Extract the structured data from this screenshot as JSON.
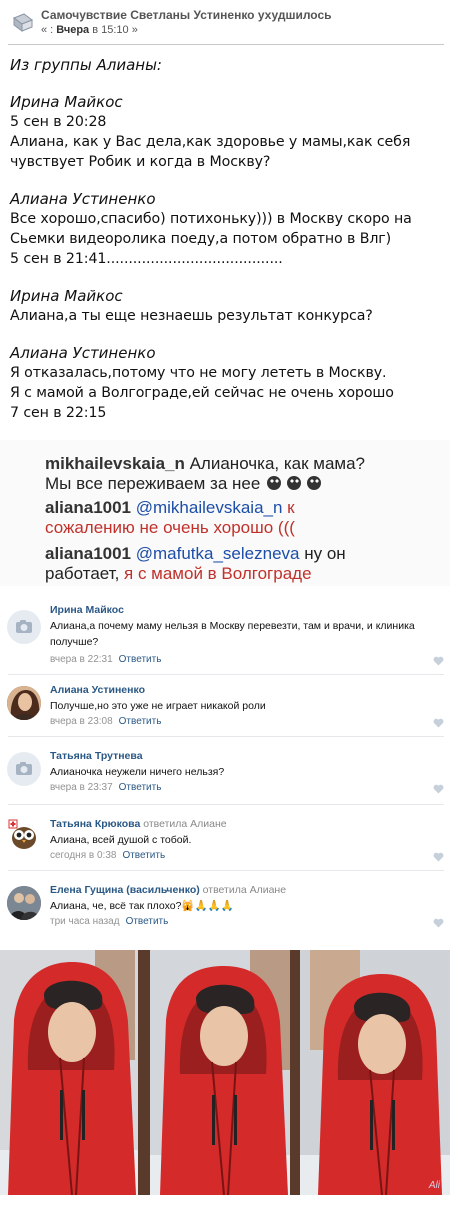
{
  "header": {
    "title": "Самочувствие Светланы Устиненко ухудшилось",
    "sub_prefix": "« : ",
    "sub_date": "Вчера",
    "sub_time": " в 15:10 »"
  },
  "quote": {
    "group_label": "Из группы Алианы:",
    "blocks": [
      {
        "author": "Ирина Майкос",
        "lines": [
          "5 сен в 20:28",
          "Алиана, как у Вас дела,как здоровье у мамы,как себя",
          "чувствует Робик и когда в Москву?"
        ]
      },
      {
        "author": "Алиана Устиненко",
        "lines": [
          "Все хорошо,спасибо) потихоньку))) в Москву скоро на",
          "Сьемки видеоролика поеду,а потом обратно в Влг)",
          "5 сен в 21:41........................................"
        ]
      },
      {
        "author": "Ирина Майкос",
        "lines": [
          "Алиана,а ты еще незнаешь результат конкурса?"
        ]
      },
      {
        "author": "Алиана Устиненко",
        "lines": [
          "Я отказалась,потому что не могу лететь в Москву.",
          "Я с мамой а Волгограде,ей сейчас не очень хорошо",
          "7 сен в 22:15"
        ]
      }
    ]
  },
  "insta": {
    "r1_user": "mikhailevskaia_n",
    "r1_text": " Алианочка, как мама?",
    "r2_text": "Мы все переживаем за нее ",
    "r3_user": "aliana1001",
    "r3_mention": " @mikhailevskaia_n",
    "r3_red": " к",
    "r4_red": "сожалению не очень хорошо (((",
    "r5_user": "aliana1001",
    "r5_mention": " @mafutka_selezneva",
    "r5_text": " ну он",
    "r6_text": "работает, ",
    "r6_red": "я с мамой в Волгограде"
  },
  "comments": [
    {
      "name": "Ирина Майкос",
      "reply": "",
      "text": "Алиана,а почему маму нельзя в Москву перевезти, там и врачи, и клиника получше?",
      "time": "вчера в 22:31",
      "answer": "Ответить"
    },
    {
      "name": "Алиана Устиненко",
      "reply": "",
      "text": "Получше,но это уже не играет никакой роли",
      "time": "вчера в 23:08",
      "answer": "Ответить"
    },
    {
      "name": "Татьяна Трутнева",
      "reply": "",
      "text": "Алианочка неужели ничего нельзя?",
      "time": "вчера в 23:37",
      "answer": "Ответить"
    },
    {
      "name": "Татьяна Крюкова",
      "reply": " ответила Алиане",
      "text": "Алиана, всей душой с тобой.",
      "time": "сегодня в 0:38",
      "answer": "Ответить"
    },
    {
      "name": "Елена Гущина (васильченко)",
      "reply": " ответила Алиане",
      "text": "Алиана, че, всё так плохо?🙀🙏🙏🙏",
      "time": "три часа назад",
      "answer": "Ответить"
    }
  ],
  "photo": {
    "signature": "Ali"
  },
  "colors": {
    "link": "#2a5885",
    "meta": "#939393",
    "red_text": "#c0312b",
    "jacket": "#d42a2a"
  }
}
